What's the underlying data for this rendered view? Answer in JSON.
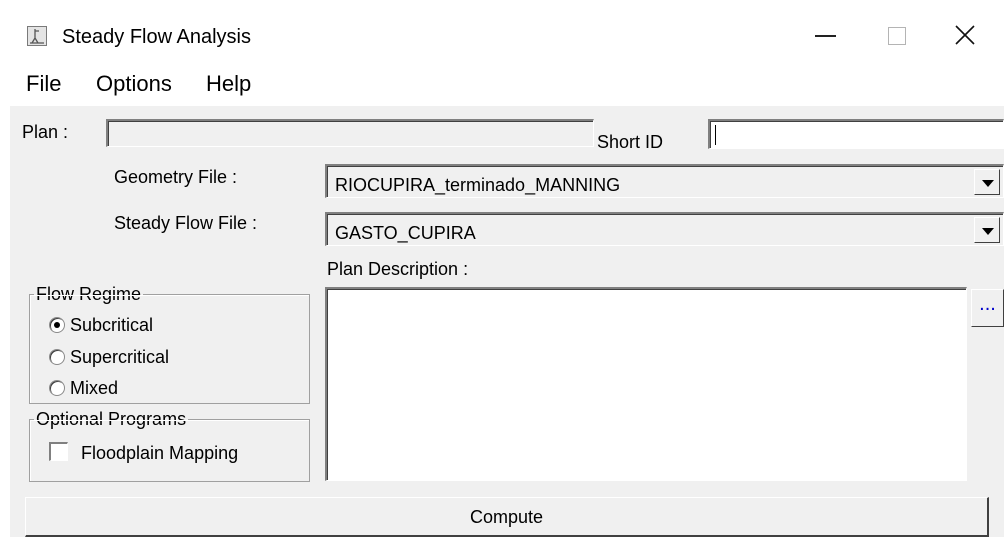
{
  "window": {
    "title": "Steady Flow Analysis",
    "app_icon": "hec-ras-icon",
    "controls": {
      "minimize_icon": "minimize-icon",
      "maximize_icon": "maximize-icon",
      "close_icon": "close-icon"
    }
  },
  "menu": {
    "items": [
      "File",
      "Options",
      "Help"
    ]
  },
  "plan": {
    "label": "Plan :",
    "value": ""
  },
  "short_id": {
    "label": "Short ID",
    "value": ""
  },
  "geometry": {
    "label": "Geometry File :",
    "selected": "RIOCUPIRA_terminado_MANNING"
  },
  "steady_flow": {
    "label": "Steady Flow File :",
    "selected": "GASTO_CUPIRA"
  },
  "plan_description": {
    "label": "Plan Description :",
    "value": "",
    "more_button": "..."
  },
  "flow_regime": {
    "title": "Flow Regime",
    "options": [
      {
        "label": "Subcritical",
        "checked": true
      },
      {
        "label": "Supercritical",
        "checked": false
      },
      {
        "label": "Mixed",
        "checked": false
      }
    ]
  },
  "optional_programs": {
    "title": "Optional Programs",
    "floodplain_mapping": {
      "label": "Floodplain Mapping",
      "checked": false
    }
  },
  "compute_button": "Compute",
  "colors": {
    "dialog_bg": "#f0f0f0",
    "titlebar_bg": "#ffffff",
    "link_blue": "#0000cc"
  }
}
